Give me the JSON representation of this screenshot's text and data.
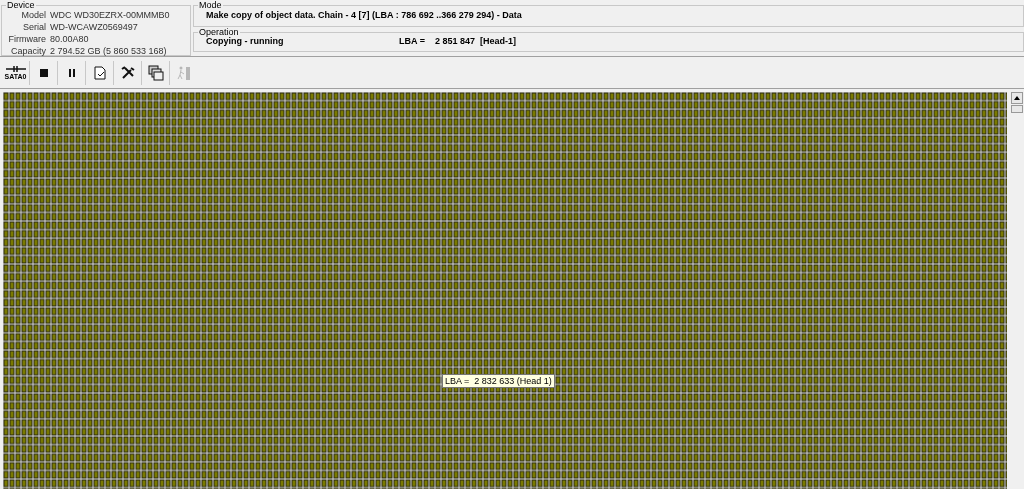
{
  "device": {
    "title": "Device",
    "fields": [
      {
        "label": "Model",
        "value": "WDC WD30EZRX-00MMMB0"
      },
      {
        "label": "Serial",
        "value": "WD-WCAWZ0569497"
      },
      {
        "label": "Firmware",
        "value": "80.00A80"
      },
      {
        "label": "Capacity",
        "value": "2 794.52 GB (5 860 533 168)"
      }
    ]
  },
  "mode": {
    "title": "Mode",
    "text": "Make copy of object data. Chain - 4 [7] (LBA : 786 692 ..366 279 294) - Data"
  },
  "operation": {
    "title": "Operation",
    "status": "Copying - running",
    "lba": "LBA =    2 851 847  [Head-1]"
  },
  "toolbar": [
    {
      "kind": "port",
      "label": "SATA0",
      "disabled": false
    },
    {
      "kind": "stop",
      "disabled": false
    },
    {
      "kind": "pause",
      "disabled": false
    },
    {
      "kind": "report",
      "disabled": false
    },
    {
      "kind": "tools",
      "disabled": false
    },
    {
      "kind": "windows",
      "disabled": false
    },
    {
      "kind": "walker",
      "disabled": true
    }
  ],
  "tooltip": "LBA =  2 832 633 (Head 1)"
}
